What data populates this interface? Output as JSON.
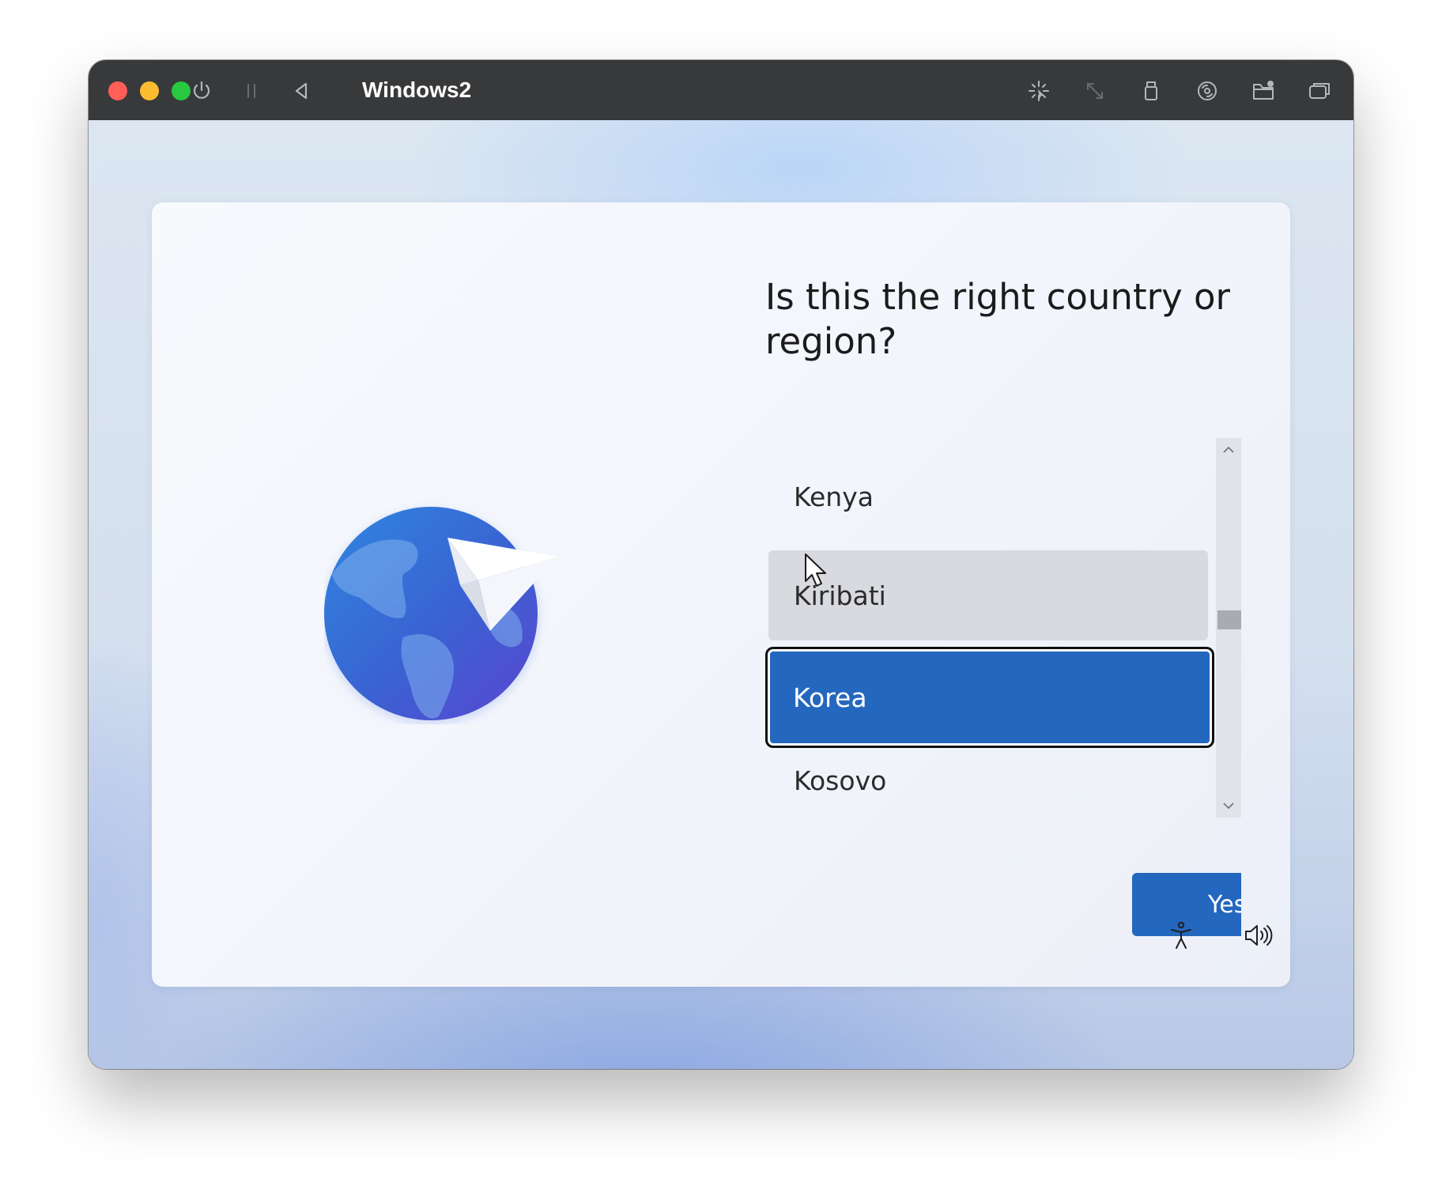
{
  "titlebar": {
    "vm_name": "Windows2",
    "icons": [
      "power-icon",
      "pause-icon",
      "back-icon",
      "capture-icon",
      "resize-icon",
      "usb-icon",
      "disc-icon",
      "shared-folder-icon",
      "display-icon"
    ]
  },
  "setup": {
    "heading": "Is this the right country or region?",
    "countries": [
      {
        "label": "Kenya",
        "state": "normal"
      },
      {
        "label": "Kiribati",
        "state": "hover"
      },
      {
        "label": "Korea",
        "state": "selected"
      },
      {
        "label": "Kosovo",
        "state": "normal"
      }
    ],
    "selected_country": "Korea",
    "yes_label": "Yes"
  },
  "taskbar": {
    "icons": [
      "accessibility-icon",
      "volume-icon"
    ]
  },
  "colors": {
    "accent": "#2467be",
    "titlebar": "#38393b",
    "close": "#ff5f57",
    "minimize": "#febc2e",
    "zoom": "#28c840"
  }
}
